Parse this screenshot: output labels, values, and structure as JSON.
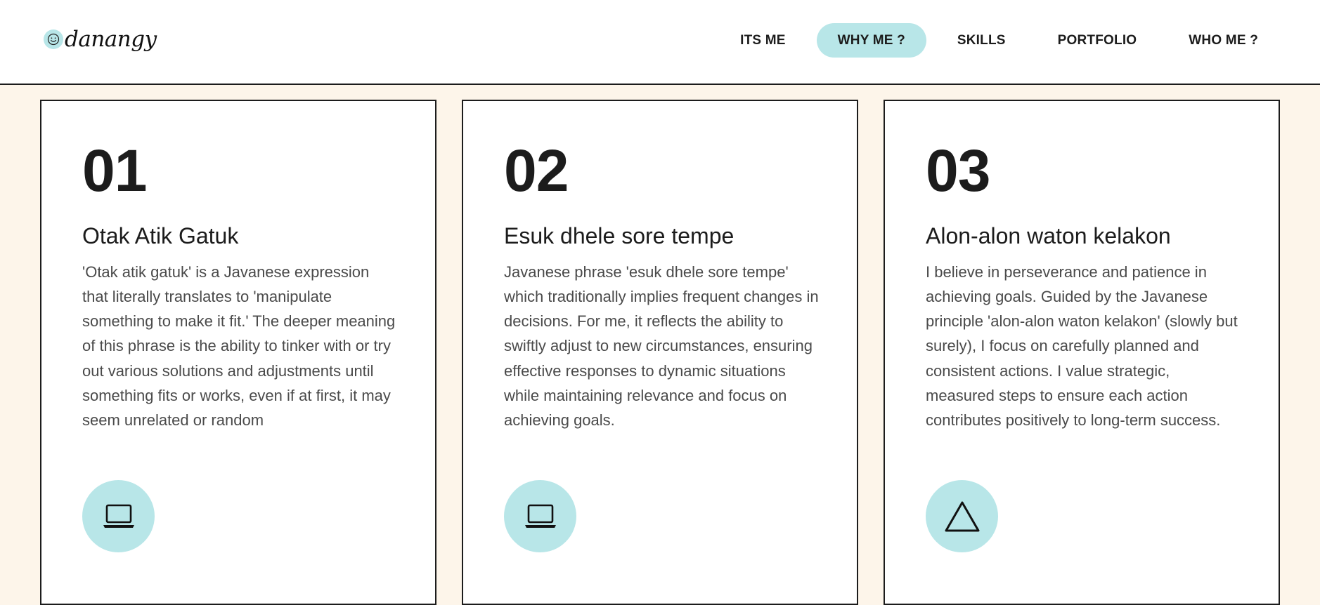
{
  "header": {
    "logo_text": "danangy",
    "logo_icon": "smiley-face-icon",
    "nav": [
      {
        "label": "ITS ME",
        "active": false
      },
      {
        "label": "WHY ME ?",
        "active": true
      },
      {
        "label": "SKILLS",
        "active": false
      },
      {
        "label": "PORTFOLIO",
        "active": false
      },
      {
        "label": "WHO ME ?",
        "active": false
      }
    ]
  },
  "colors": {
    "accent": "#b8e6e8",
    "page_background": "#fdf5ea",
    "text_dark": "#1c1c1c",
    "text_body": "#4a4a4a"
  },
  "cards": [
    {
      "number": "01",
      "title": "Otak Atik Gatuk",
      "text": "'Otak atik gatuk' is a Javanese expression that literally translates to 'manipulate something to make it fit.' The deeper meaning of this phrase is the ability to tinker with or try out various solutions and adjustments until something fits or works, even if at first, it may seem unrelated or random",
      "icon": "laptop-icon"
    },
    {
      "number": "02",
      "title": "Esuk dhele sore tempe",
      "text": "Javanese phrase 'esuk dhele sore tempe' which traditionally implies frequent changes in decisions. For me, it reflects the ability to swiftly adjust to new circumstances, ensuring effective responses to dynamic situations while maintaining relevance and focus on achieving goals.",
      "icon": "laptop-icon"
    },
    {
      "number": "03",
      "title": "Alon-alon waton kelakon",
      "text": "I believe in perseverance and patience in achieving goals. Guided by the Javanese principle 'alon-alon waton kelakon' (slowly but surely), I focus on carefully planned and consistent actions. I value strategic, measured steps to ensure each action contributes positively to long-term success.",
      "icon": "triangle-icon"
    }
  ]
}
